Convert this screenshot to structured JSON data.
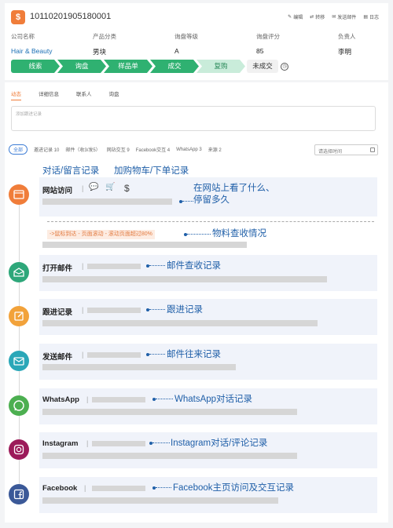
{
  "header": {
    "record_id": "10110201905180001",
    "actions": [
      "编辑",
      "转移",
      "发送邮件",
      "日志"
    ]
  },
  "fields": [
    {
      "label": "公司名称",
      "value": "Hair & Beauty"
    },
    {
      "label": "产品分类",
      "value": "男块"
    },
    {
      "label": "询盘等级",
      "value": "A"
    },
    {
      "label": "询盘评分",
      "value": "85"
    },
    {
      "label": "负责人",
      "value": "李明"
    }
  ],
  "stages": [
    "线索",
    "询盘",
    "样品单",
    "成交",
    "复购"
  ],
  "lost_label": "未成交",
  "tabs": [
    "动态",
    "详细信息",
    "联系人",
    "询盘"
  ],
  "note_placeholder": "添加跟进记录",
  "filters": [
    "全部",
    "邀进记录 10",
    "邮件（收3/发5）",
    "网站交互 9",
    "Facebook交互 4",
    "WhatsApp 3",
    "来源 2"
  ],
  "date_placeholder": "请选择时间",
  "annotations": {
    "chat": "对话/留言记录",
    "cart": "加购物车/下单记录",
    "web": "在网站上看了什么、\n停留多久",
    "material": "物料查收情况",
    "mail_check": "邮件查收记录",
    "followup": "跟进记录",
    "mail_exchange": "邮件往来记录",
    "whatsapp": "WhatsApp对话记录",
    "instagram": "Instagram对话/评论记录",
    "facebook": "Facebook主页访问及交互记录"
  },
  "timeline": {
    "web_visit": "网站访问",
    "web_tag": "->鼠标到达 - 页面滚动 - 滚动页面超过80%",
    "open_mail": "打开邮件",
    "followup": "跟进记录",
    "send_mail": "发送邮件",
    "whatsapp": "WhatsApp",
    "instagram": "Instagram",
    "facebook": "Facebook"
  },
  "colors": {
    "accent": "#f07d3a",
    "stage_green": "#2fb171",
    "annotation_blue": "#1f5fa8",
    "web_icon": "#f07d3a",
    "mail_icon": "#2ea77a",
    "followup_icon": "#f2a23a",
    "send_icon": "#2aa7b8",
    "whatsapp_icon": "#4caf50",
    "instagram_icon": "#9c1b5a",
    "facebook_icon": "#3b5998"
  }
}
